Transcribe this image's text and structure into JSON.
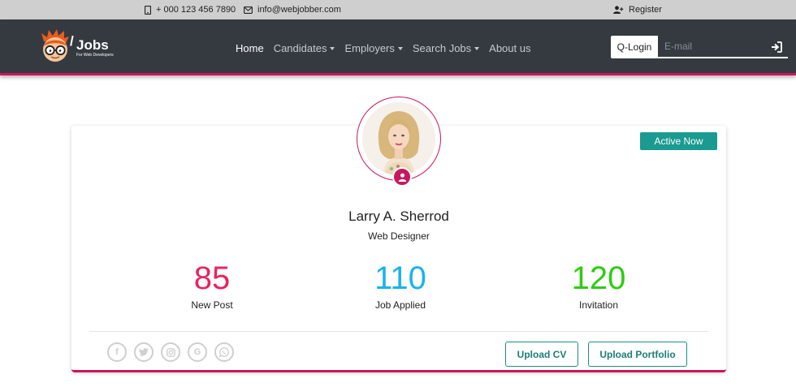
{
  "topbar": {
    "phone": "+ 000 123 456 7890",
    "email": "info@webjobber.com",
    "register": "Register"
  },
  "brand": {
    "name": "Jobs",
    "slash": "/",
    "tagline": "For Web Developers"
  },
  "nav": {
    "items": [
      {
        "label": "Home",
        "active": true,
        "dropdown": false
      },
      {
        "label": "Candidates",
        "active": false,
        "dropdown": true
      },
      {
        "label": "Employers",
        "active": false,
        "dropdown": true
      },
      {
        "label": "Search Jobs",
        "active": false,
        "dropdown": true
      },
      {
        "label": "About us",
        "active": false,
        "dropdown": false
      }
    ]
  },
  "qlogin": {
    "label": "Q-Login",
    "placeholder": "E-mail"
  },
  "profile": {
    "status": "Active Now",
    "name": "Larry A. Sherrod",
    "role": "Web Designer",
    "stats": [
      {
        "value": "85",
        "label": "New Post",
        "color": "#e8245f"
      },
      {
        "value": "110",
        "label": "Job Applied",
        "color": "#1ab2ec"
      },
      {
        "value": "120",
        "label": "Invitation",
        "color": "#2ecc12"
      }
    ],
    "socials": [
      "facebook-icon",
      "twitter-icon",
      "instagram-icon",
      "google-icon",
      "whatsapp-icon"
    ],
    "actions": {
      "upload_cv": "Upload CV",
      "upload_portfolio": "Upload Portfolio"
    }
  },
  "colors": {
    "accent": "#c8175d",
    "teal": "#1a9a91",
    "navbar": "#343a40",
    "topbar": "#cfcfcf"
  }
}
